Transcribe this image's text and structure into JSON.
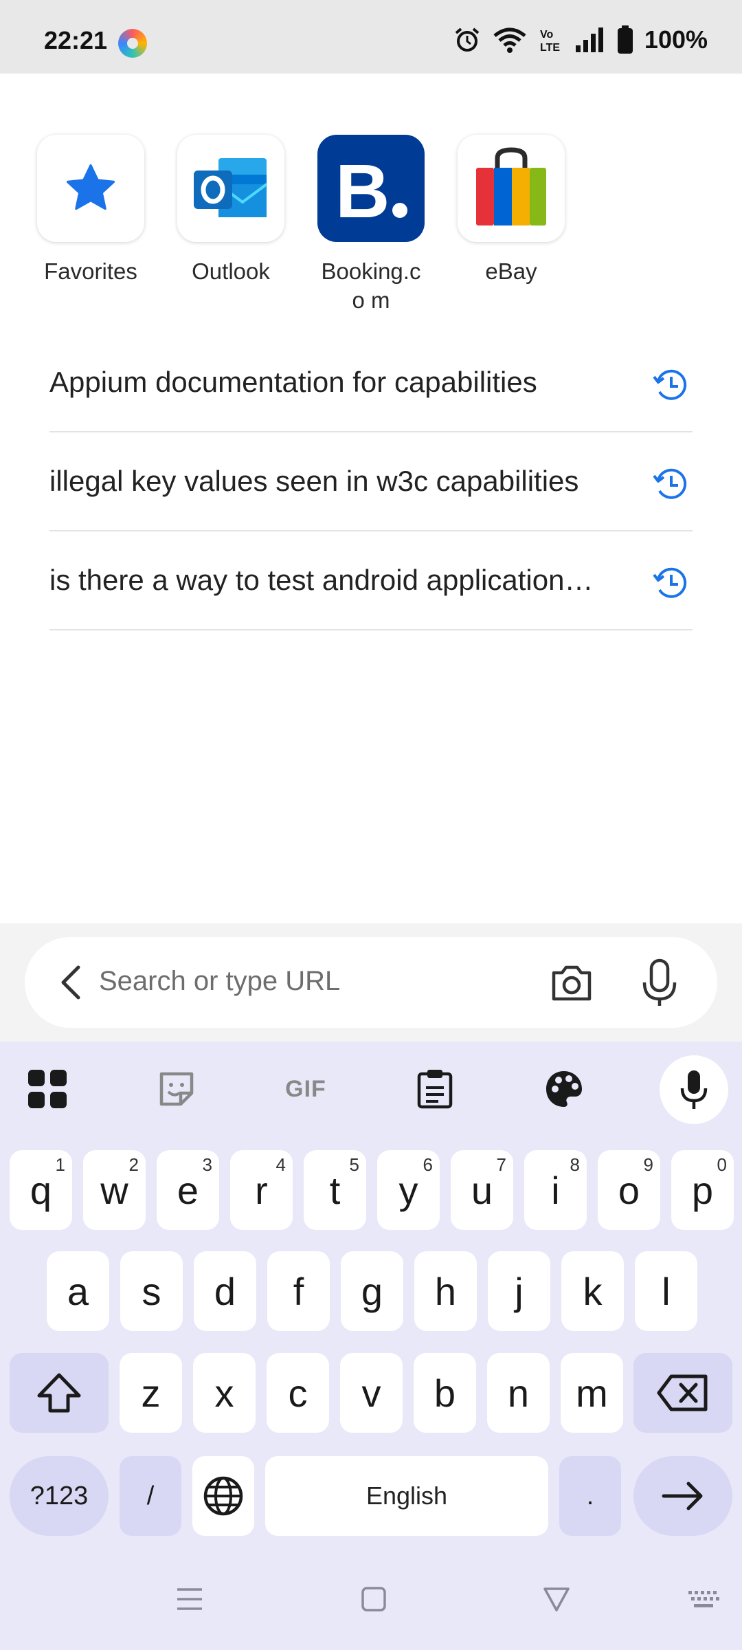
{
  "status_bar": {
    "time": "22:21",
    "battery": "100%",
    "icons": [
      "app-icon",
      "alarm-icon",
      "wifi-icon",
      "volte-icon",
      "signal-icon",
      "battery-icon"
    ]
  },
  "shortcuts": [
    {
      "label": "Favorites",
      "icon": "star-icon"
    },
    {
      "label": "Outlook",
      "icon": "outlook-icon"
    },
    {
      "label": "Booking.co m",
      "icon": "booking-icon"
    },
    {
      "label": "eBay",
      "icon": "ebay-icon"
    }
  ],
  "history": [
    {
      "text": "Appium documentation for capabilities"
    },
    {
      "text": "illegal key values seen in w3c capabilities"
    },
    {
      "text": "is there a way to test android application…"
    }
  ],
  "search": {
    "placeholder": "Search or type URL"
  },
  "keyboard": {
    "toolbar": [
      "apps-grid-icon",
      "sticker-icon",
      "gif-icon",
      "clipboard-icon",
      "palette-icon",
      "mic-icon"
    ],
    "gif_label": "GIF",
    "row1": [
      {
        "k": "q",
        "h": "1"
      },
      {
        "k": "w",
        "h": "2"
      },
      {
        "k": "e",
        "h": "3"
      },
      {
        "k": "r",
        "h": "4"
      },
      {
        "k": "t",
        "h": "5"
      },
      {
        "k": "y",
        "h": "6"
      },
      {
        "k": "u",
        "h": "7"
      },
      {
        "k": "i",
        "h": "8"
      },
      {
        "k": "o",
        "h": "9"
      },
      {
        "k": "p",
        "h": "0"
      }
    ],
    "row2": [
      "a",
      "s",
      "d",
      "f",
      "g",
      "h",
      "j",
      "k",
      "l"
    ],
    "row3": [
      "z",
      "x",
      "c",
      "v",
      "b",
      "n",
      "m"
    ],
    "symbols_label": "?123",
    "slash_label": "/",
    "space_label": "English",
    "period_label": "."
  },
  "colors": {
    "accent_blue": "#1a73e8",
    "keyboard_bg": "#e8e8f8",
    "fn_key": "#d8d8f4"
  }
}
